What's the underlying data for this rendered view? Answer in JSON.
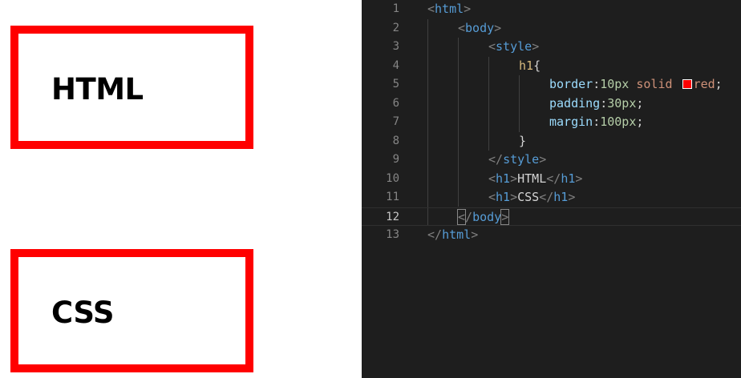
{
  "preview": {
    "headings": [
      "HTML",
      "CSS"
    ],
    "border_color": "#ff0000"
  },
  "editor": {
    "active_line": 12,
    "lines": [
      {
        "n": "1"
      },
      {
        "n": "2"
      },
      {
        "n": "3"
      },
      {
        "n": "4"
      },
      {
        "n": "5"
      },
      {
        "n": "6"
      },
      {
        "n": "7"
      },
      {
        "n": "8"
      },
      {
        "n": "9"
      },
      {
        "n": "10"
      },
      {
        "n": "11"
      },
      {
        "n": "12"
      },
      {
        "n": "13"
      }
    ],
    "tokens": {
      "html_tag": "html",
      "body_tag": "body",
      "style_tag": "style",
      "selector": "h1",
      "open_brace": "{",
      "close_brace": "}",
      "prop_border": "border",
      "val_border_num": "10px",
      "val_border_style": "solid",
      "val_border_color": "red",
      "prop_padding": "padding",
      "val_padding": "30px",
      "prop_margin": "margin",
      "val_margin": "100px",
      "h1_tag": "h1",
      "h1_text_1": "HTML",
      "h1_text_2": "CSS"
    },
    "colors": {
      "background": "#1e1e1e",
      "tag": "#569cd6",
      "selector": "#d7ba7d",
      "property": "#9cdcfe",
      "number": "#b5cea8",
      "string": "#ce9178"
    }
  }
}
